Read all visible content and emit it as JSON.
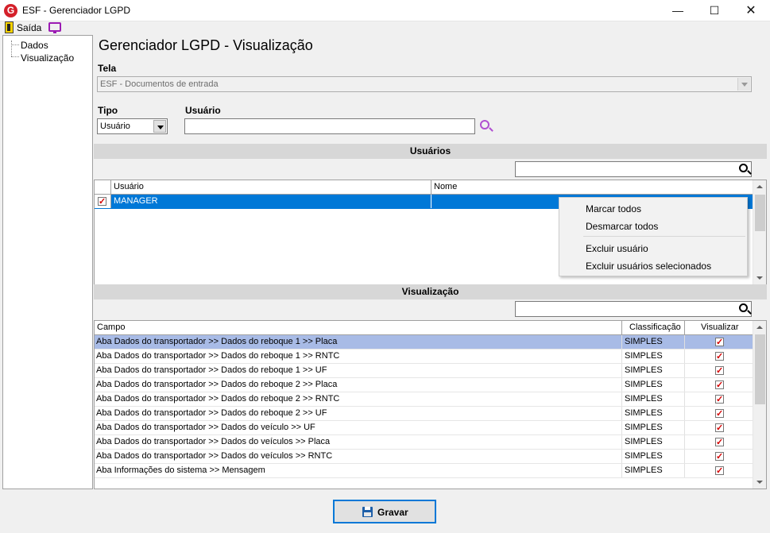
{
  "window": {
    "title": "ESF - Gerenciador LGPD",
    "logo_letter": "G",
    "minimize": "—",
    "maximize": "☐",
    "close": "✕"
  },
  "toolbar": {
    "exit_label": "Saída"
  },
  "tree": {
    "items": [
      "Dados",
      "Visualização"
    ]
  },
  "page": {
    "title": "Gerenciador LGPD - Visualização"
  },
  "tela": {
    "label": "Tela",
    "value": "ESF - Documentos de entrada"
  },
  "tipo": {
    "label": "Tipo",
    "value": "Usuário"
  },
  "usuario": {
    "label": "Usuário",
    "value": ""
  },
  "users_section": {
    "header": "Usuários",
    "columns": [
      "Usuário",
      "Nome"
    ],
    "rows": [
      {
        "checked": true,
        "usuario": "MANAGER",
        "nome": ""
      }
    ]
  },
  "context_menu": {
    "items": [
      "Marcar todos",
      "Desmarcar todos",
      "Excluir usuário",
      "Excluir usuários selecionados"
    ]
  },
  "view_section": {
    "header": "Visualização",
    "columns": [
      "Campo",
      "Classificação",
      "Visualizar"
    ],
    "rows": [
      {
        "campo": "Aba Dados do transportador >> Dados do reboque 1 >> Placa",
        "classificacao": "SIMPLES",
        "visualizar": true
      },
      {
        "campo": "Aba Dados do transportador >> Dados do reboque 1 >> RNTC",
        "classificacao": "SIMPLES",
        "visualizar": true
      },
      {
        "campo": "Aba Dados do transportador >> Dados do reboque 1 >> UF",
        "classificacao": "SIMPLES",
        "visualizar": true
      },
      {
        "campo": "Aba Dados do transportador >> Dados do reboque 2 >> Placa",
        "classificacao": "SIMPLES",
        "visualizar": true
      },
      {
        "campo": "Aba Dados do transportador >> Dados do reboque 2 >> RNTC",
        "classificacao": "SIMPLES",
        "visualizar": true
      },
      {
        "campo": "Aba Dados do transportador >> Dados do reboque 2 >> UF",
        "classificacao": "SIMPLES",
        "visualizar": true
      },
      {
        "campo": "Aba Dados do transportador >> Dados do veículo >> UF",
        "classificacao": "SIMPLES",
        "visualizar": true
      },
      {
        "campo": "Aba Dados do transportador >> Dados do veículos >> Placa",
        "classificacao": "SIMPLES",
        "visualizar": true
      },
      {
        "campo": "Aba Dados do transportador >> Dados do veículos >> RNTC",
        "classificacao": "SIMPLES",
        "visualizar": true
      },
      {
        "campo": "Aba Informações do sistema >> Mensagem",
        "classificacao": "SIMPLES",
        "visualizar": true
      }
    ]
  },
  "save_button": {
    "label": "Gravar"
  },
  "colors": {
    "selection": "#0078d7",
    "row_highlight": "#a8bbe6",
    "check_red": "#d40000",
    "section_header": "#d7d7d7"
  }
}
